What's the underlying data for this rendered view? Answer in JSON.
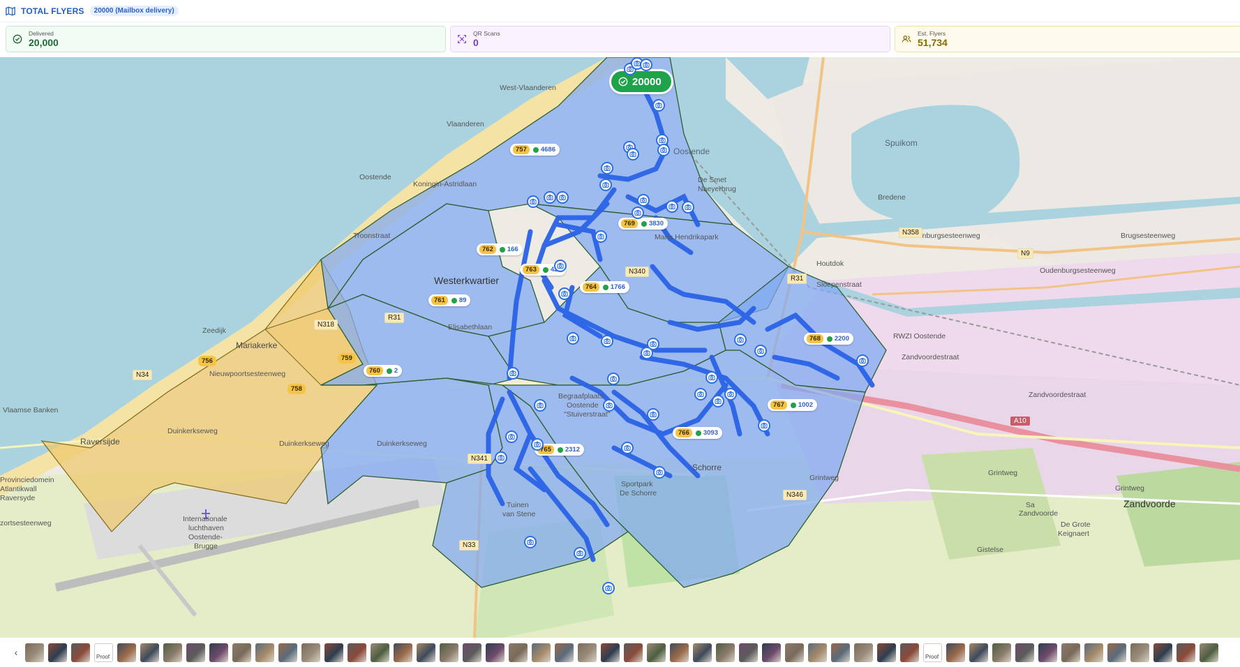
{
  "header": {
    "title": "TOTAL FLYERS",
    "badge": "20000 (Mailbox delivery)",
    "icon": "map-icon"
  },
  "stats": {
    "delivered": {
      "label": "Delivered",
      "value": "20,000",
      "icon": "check-circle-icon",
      "color": "#1f6b34"
    },
    "qr": {
      "label": "QR Scans",
      "value": "0",
      "icon": "qr-scan-icon",
      "color": "#7b3bc8"
    },
    "est": {
      "label": "Est. Flyers",
      "value": "51,734",
      "icon": "users-icon",
      "color": "#8a6a00"
    }
  },
  "map": {
    "total_pill": "20000",
    "zones": [
      {
        "id": "757",
        "count": "4686"
      },
      {
        "id": "769",
        "count": "3830"
      },
      {
        "id": "762",
        "count": "166"
      },
      {
        "id": "763",
        "count": "428"
      },
      {
        "id": "764",
        "count": "1766"
      },
      {
        "id": "761",
        "count": "89"
      },
      {
        "id": "768",
        "count": "2200"
      },
      {
        "id": "760",
        "count": "2"
      },
      {
        "id": "767",
        "count": "1002"
      },
      {
        "id": "766",
        "count": "3093"
      },
      {
        "id": "765",
        "count": "2312"
      }
    ],
    "unserved_zones": [
      "756",
      "759",
      "758"
    ],
    "labels": {
      "westerkwartier": "Westerkwartier",
      "mariakerke": "Mariakerke",
      "raversijde": "Raversijde",
      "oostende": "Oostende",
      "spuikom": "Spuikom",
      "bredene": "Bredene",
      "mariahendrikapark": "Maria Hendrikapark",
      "desmet": "De Smet",
      "naeyerbrug": "Naeyerbrug",
      "schorre": "Schorre",
      "sportpark": "Sportpark",
      "sportpark2": "De Schorre",
      "tuinen": "Tuinen",
      "tuinen2": "van Stene",
      "zandvoorde": "Zandvoorde",
      "rwzi": "RWZI Oostende",
      "begraaf1": "Begraafplaats",
      "begraaf2": "Oostende",
      "begraaf3": "\"Stuiverstraat\"",
      "airport1": "Internationale",
      "airport2": "luchthaven",
      "airport3": "Oostende-",
      "airport4": "Brugge",
      "duinkerkseweg1": "Duinkerkseweg",
      "duinkerkseweg2": "Duinkerkseweg",
      "duinkerkseweg3": "Duinkerkseweg",
      "zandvoordestraat1": "Zandvoordestraat",
      "zandvoordestraat2": "Zandvoordestraat",
      "oudenburg1": "Oudenburgsesteenweg",
      "oudenburg2": "Oudenburgsesteenweg",
      "brugse": "Brugsesteenweg",
      "grintweg1": "Grintweg",
      "grintweg2": "Grintweg",
      "grintweg3": "Grintweg",
      "nieuwpoort": "Nieuwpoortsesteenweg",
      "koningin": "Koningin-Astridlaan",
      "troonstraat": "Troonstraat",
      "elisabethlaan": "Elisabethlaan",
      "vlaamse": "Vlaamse Banken",
      "vlaanderen": "Vlaanderen",
      "westvlaanderen": "West-Vlaanderen",
      "houtdok": "Houtdok",
      "slopen": "Sloepenstraat",
      "zeedijk": "Zeedijk",
      "oostende_sea": "Oostende",
      "n9": "N9",
      "n358": "N358",
      "a10": "A10",
      "n34": "N34",
      "n318": "N318",
      "n341": "N341",
      "n33": "N33",
      "n346": "N346",
      "r31": "R31",
      "r31b": "R31",
      "n340": "N340",
      "zandvoorde_sa": "Zandvoorde",
      "zandvoorde_sa2": "Sa",
      "grote_keignaert": "De Grote",
      "grote_keignaert2": "Keignaert",
      "gistel": "Gistelse",
      "artillerie1": "Provinciedomein",
      "artillerie2": "Atlantikwall",
      "artillerie3": "Raversyde",
      "zortseweg": "zortsesteenweg"
    }
  },
  "thumbnails": {
    "proof_label": "Proof",
    "count": 52
  },
  "colors": {
    "zone_fill": "#7fa9f2",
    "route": "#2b63e6",
    "unserved_fill": "#efc86a",
    "sea": "#a9d3df"
  }
}
